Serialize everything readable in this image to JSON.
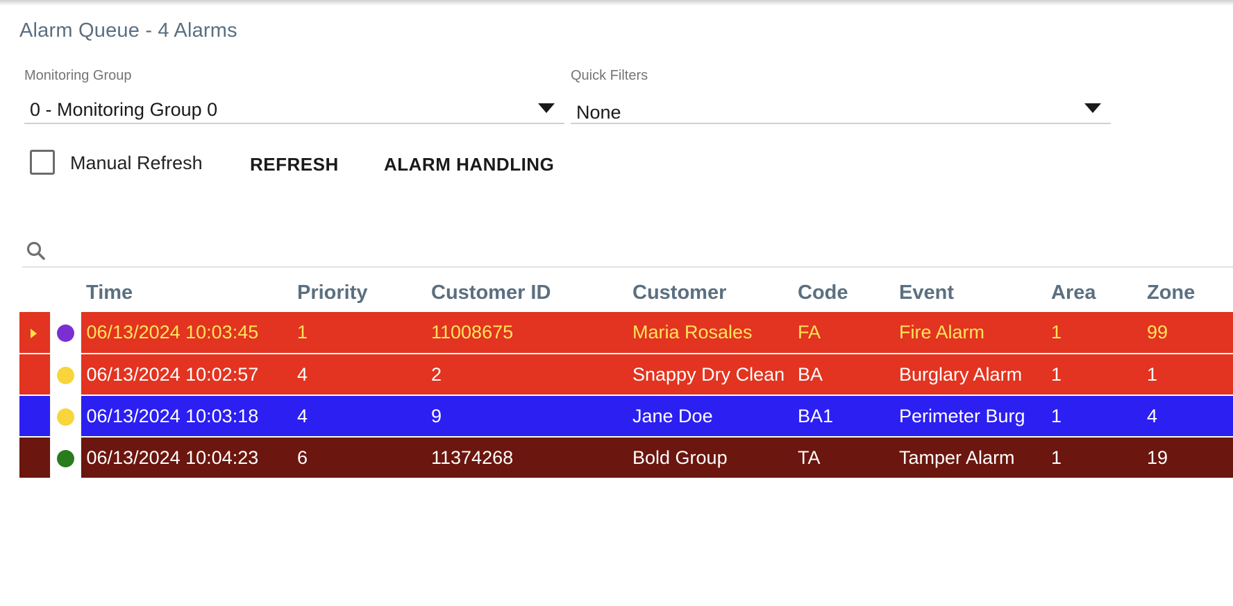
{
  "header": {
    "title": "Alarm Queue - 4 Alarms"
  },
  "filters": {
    "monitoring_group": {
      "label": "Monitoring Group",
      "value": "0 - Monitoring Group 0"
    },
    "quick_filters": {
      "label": "Quick Filters",
      "value": "None"
    }
  },
  "controls": {
    "manual_refresh_label": "Manual Refresh",
    "manual_refresh_checked": false,
    "refresh_label": "REFRESH",
    "alarm_handling_label": "ALARM HANDLING"
  },
  "search": {
    "icon": "search-icon",
    "value": ""
  },
  "table": {
    "columns": [
      "Time",
      "Priority",
      "Customer ID",
      "Customer",
      "Code",
      "Event",
      "Area",
      "Zone"
    ],
    "rows": [
      {
        "selected": true,
        "dot_color": "#7b2fd1",
        "bg": "#e23420",
        "fg": "#ffe45c",
        "time": "06/13/2024 10:03:45",
        "priority": "1",
        "customer_id": "11008675",
        "customer": "Maria Rosales",
        "code": "FA",
        "event": "Fire Alarm",
        "area": "1",
        "zone": "99"
      },
      {
        "selected": false,
        "dot_color": "#f7d53b",
        "bg": "#e23420",
        "fg": "#ffffff",
        "time": "06/13/2024 10:02:57",
        "priority": "4",
        "customer_id": "2",
        "customer": "Snappy Dry Clean",
        "code": "BA",
        "event": "Burglary Alarm",
        "area": "1",
        "zone": "1"
      },
      {
        "selected": false,
        "dot_color": "#f7d53b",
        "bg": "#2b1ff2",
        "fg": "#ffffff",
        "time": "06/13/2024 10:03:18",
        "priority": "4",
        "customer_id": "9",
        "customer": "Jane Doe",
        "code": "BA1",
        "event": "Perimeter Burg",
        "area": "1",
        "zone": "4"
      },
      {
        "selected": false,
        "dot_color": "#2a7a1e",
        "bg": "#6b160e",
        "fg": "#ffffff",
        "time": "06/13/2024 10:04:23",
        "priority": "6",
        "customer_id": "11374268",
        "customer": "Bold Group",
        "code": "TA",
        "event": "Tamper Alarm",
        "area": "1",
        "zone": "19"
      }
    ]
  }
}
